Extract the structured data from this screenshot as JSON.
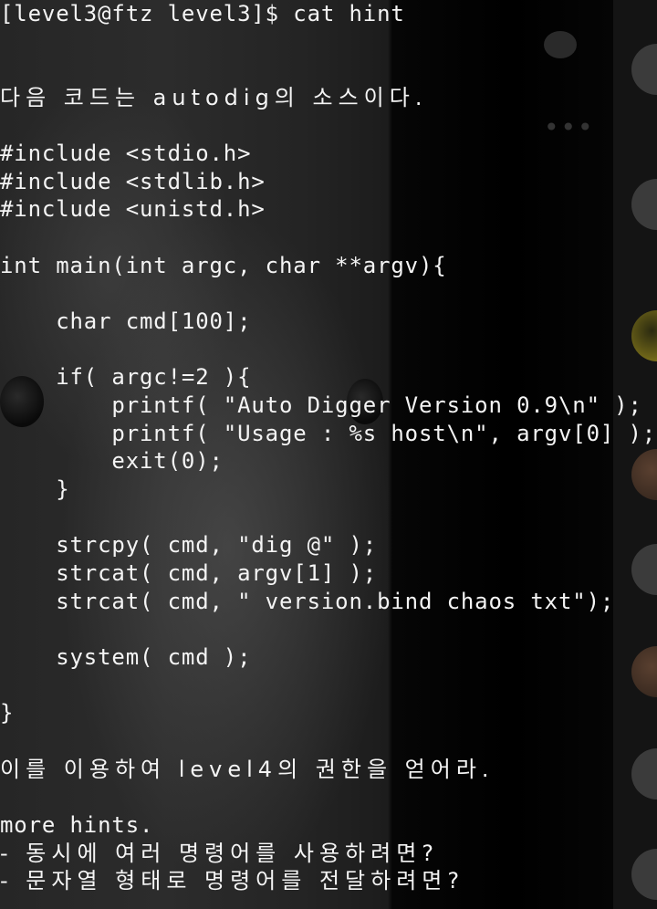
{
  "terminal": {
    "lines": [
      "[level3@ftz level3]$ cat hint",
      "",
      "",
      "다음 코드는 autodig의 소스이다.",
      "",
      "#include <stdio.h>",
      "#include <stdlib.h>",
      "#include <unistd.h>",
      "",
      "int main(int argc, char **argv){",
      "",
      "    char cmd[100];",
      "",
      "    if( argc!=2 ){",
      "        printf( \"Auto Digger Version 0.9\\n\" );",
      "        printf( \"Usage : %s host\\n\", argv[0] );",
      "        exit(0);",
      "    }",
      "",
      "    strcpy( cmd, \"dig @\" );",
      "    strcat( cmd, argv[1] );",
      "    strcat( cmd, \" version.bind chaos txt\");",
      "",
      "    system( cmd );",
      "",
      "}",
      "",
      "이를 이용하여 level4의 권한을 얻어라.",
      "",
      "more hints.",
      "- 동시에 여러 명령어를 사용하려면?",
      "- 문자열 형태로 명령어를 전달하려면?"
    ]
  },
  "side_panel": {
    "icons": [
      "chat-bubble-icon",
      "more-dots-icon"
    ]
  }
}
